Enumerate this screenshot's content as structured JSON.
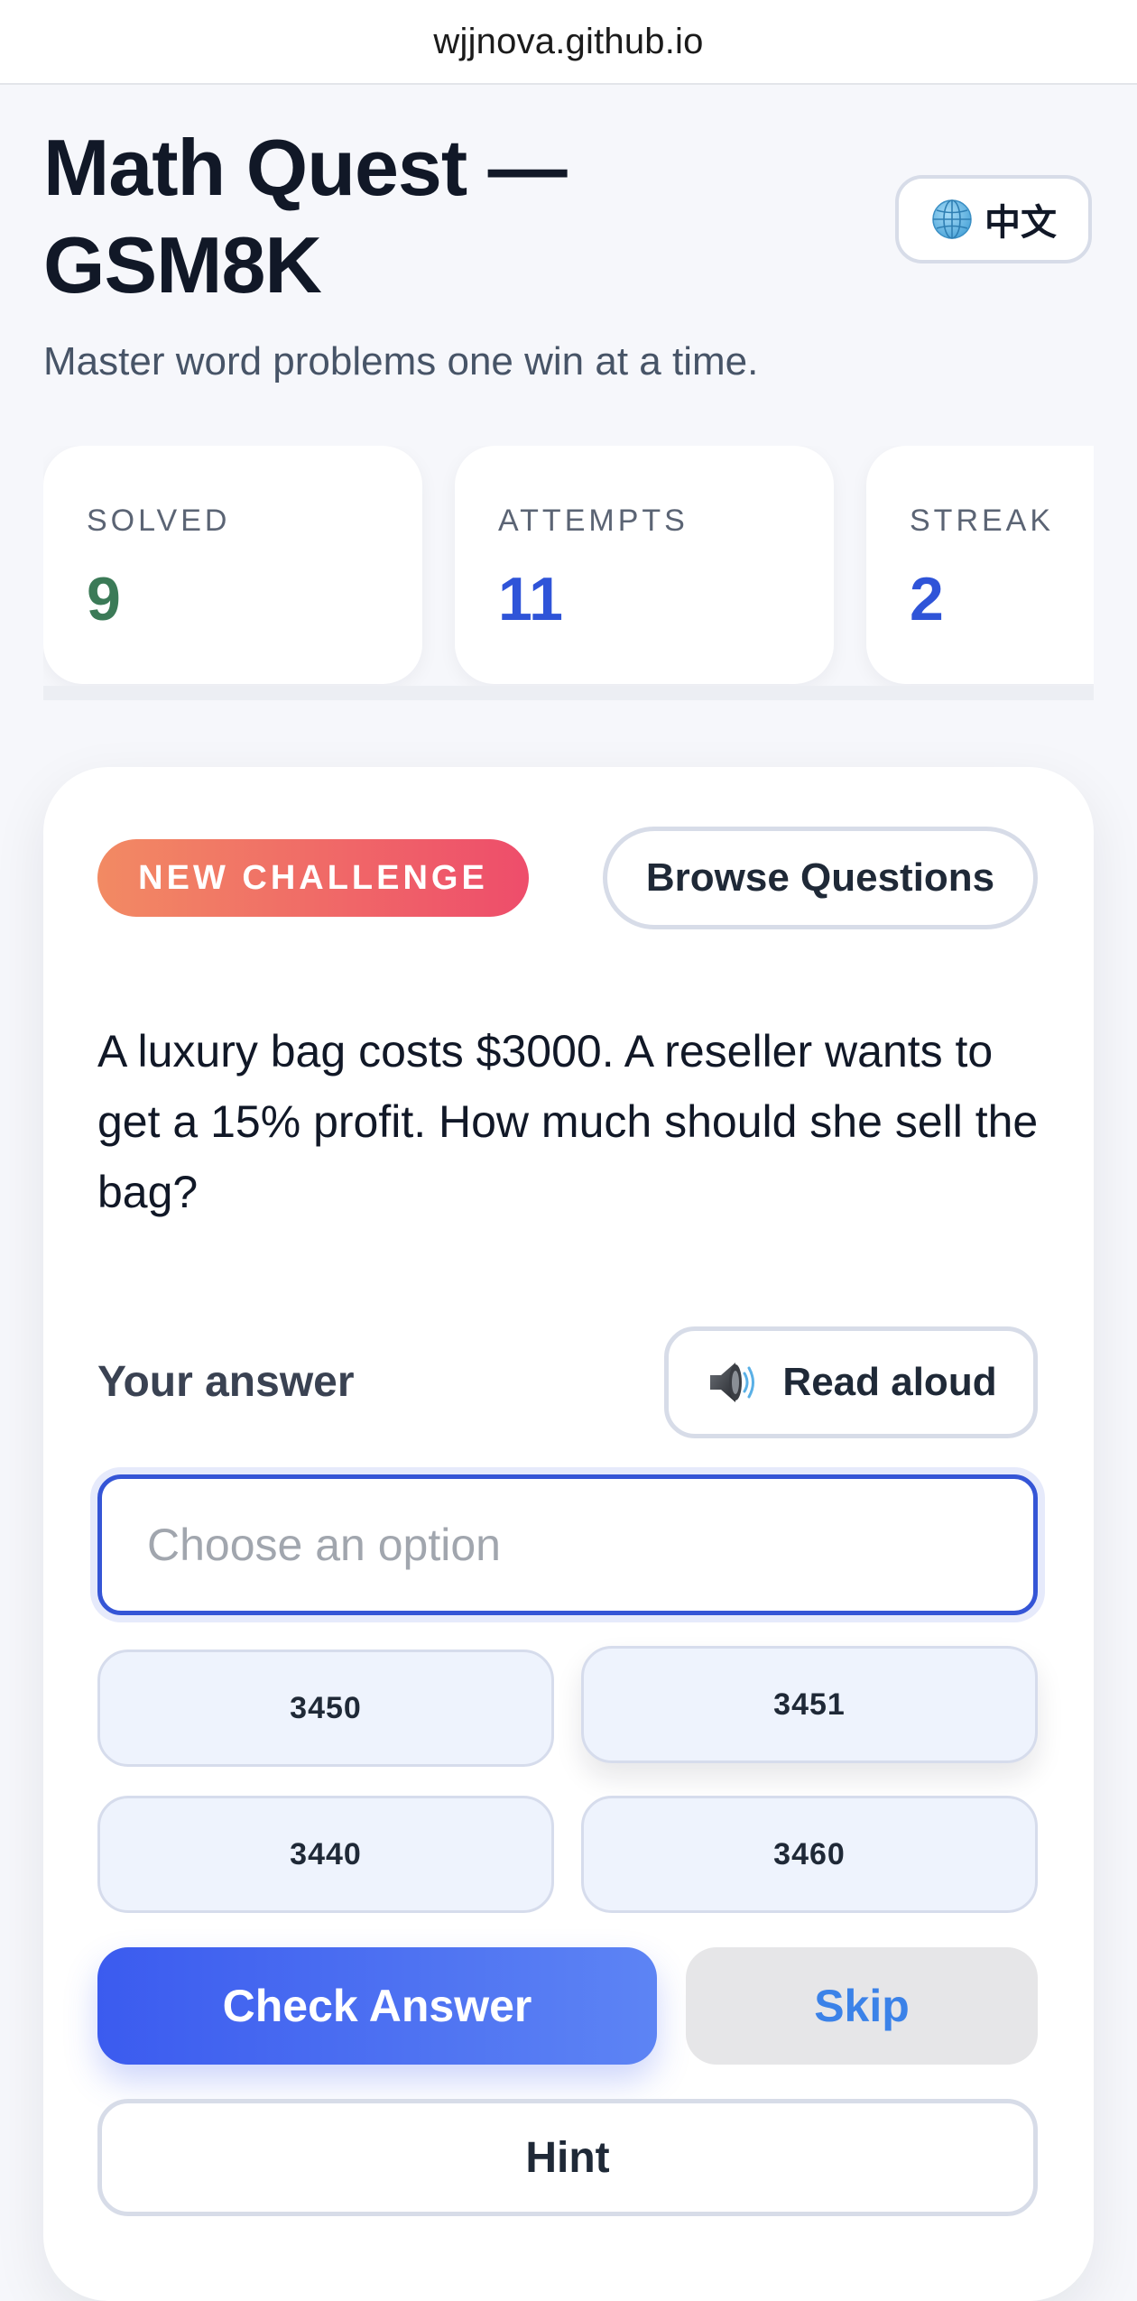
{
  "browser": {
    "url": "wjjnova.github.io"
  },
  "header": {
    "title": "Math Quest — GSM8K",
    "subtitle": "Master word problems one win at a time.",
    "language_button": {
      "icon": "globe-icon",
      "label": "中文"
    }
  },
  "stats": [
    {
      "label": "SOLVED",
      "value": "9",
      "color": "#3b7a57"
    },
    {
      "label": "ATTEMPTS",
      "value": "11",
      "color": "#2f54d8"
    },
    {
      "label": "STREAK",
      "value": "2",
      "color": "#2f54d8"
    }
  ],
  "challenge": {
    "badge": "NEW CHALLENGE",
    "browse_label": "Browse Questions",
    "question": "A luxury bag costs $3000. A reseller wants to get a 15% profit. How much should she sell the bag?",
    "answer_label": "Your answer",
    "read_aloud": {
      "icon": "speaker-icon",
      "label": "Read aloud"
    },
    "answer_input": {
      "value": "",
      "placeholder": "Choose an option"
    },
    "options": [
      "3450",
      "3451",
      "3440",
      "3460"
    ],
    "check_label": "Check Answer",
    "skip_label": "Skip",
    "hint_label": "Hint"
  },
  "colors": {
    "accent": "#3555d6",
    "badge_gradient": [
      "#f28a63",
      "#ee4d6b"
    ],
    "check_gradient": [
      "#3b5bef",
      "#5d84f4"
    ],
    "skip_text": "#3b82e8"
  }
}
